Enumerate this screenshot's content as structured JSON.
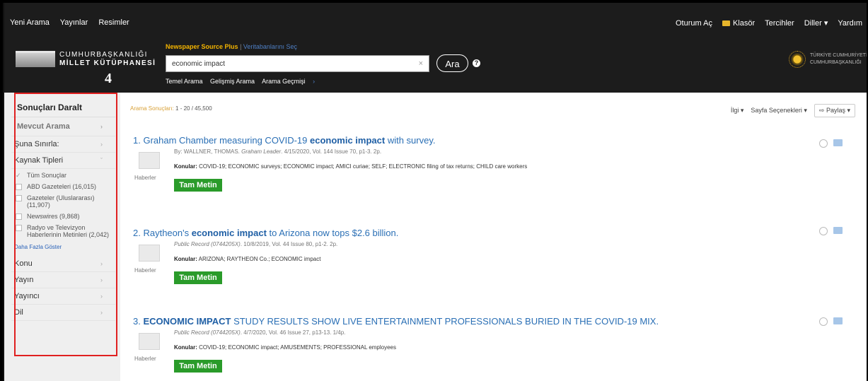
{
  "topnav": {
    "links": [
      "Yeni Arama",
      "Yayınlar",
      "Resimler"
    ]
  },
  "topnav_right": {
    "oturum": "Oturum Aç",
    "klasor": "Klasör",
    "tercihler": "Tercihler",
    "diller": "Diller ▾",
    "yardim": "Yardım"
  },
  "logo": {
    "line1": "CUMHURBAŞKANLIĞI",
    "line2": "MİLLET KÜTÜPHANESİ"
  },
  "annotation_number": "4",
  "search": {
    "database": "Newspaper Source Plus",
    "select_db": "Veritabanlarını Seç",
    "query": "economic impact",
    "button": "Ara",
    "help": "?"
  },
  "search_links": [
    "Temel Arama",
    "Gelişmiş Arama",
    "Arama Geçmişi"
  ],
  "gov_logo": {
    "line1": "TÜRKİYE CUMHURİYETİ",
    "line2": "CUMHURBAŞKANLIĞI"
  },
  "sidebar": {
    "title": "Sonuçları Daralt",
    "current": "Mevcut Arama",
    "limit": "Şuna Sınırla:",
    "source_types": "Kaynak Tipleri",
    "options": [
      {
        "label": "Tüm Sonuçlar",
        "checked": true
      },
      {
        "label": "ABD Gazeteleri (16,015)",
        "checked": false
      },
      {
        "label": "Gazeteler (Uluslararası) (11,907)",
        "checked": false
      },
      {
        "label": "Newswires (9,868)",
        "checked": false
      },
      {
        "label": "Radyo ve Televizyon Haberlerinin Metinleri (2,042)",
        "checked": false
      }
    ],
    "more": "Daha Fazla Göster",
    "facets": [
      "Konu",
      "Yayın",
      "Yayıncı",
      "Dil"
    ]
  },
  "results_header": {
    "label": "Arama Sonuçları:",
    "range": "1 - 20 / 45,500"
  },
  "tools": {
    "relevance": "İlgi ▾",
    "page_options": "Sayfa Seçenekleri ▾",
    "share": "Paylaş ▾"
  },
  "results": [
    {
      "num": "1.",
      "title_a": "Graham Chamber measuring COVID-19 ",
      "title_b": "economic impact",
      "title_c": " with survey.",
      "by": "By: WALLNER, THOMAS. ",
      "source": "Graham Leader",
      "details": ". 4/15/2020, Vol. 144 Issue 70, p1-3. 2p.",
      "kon_label": "Konular:",
      "kon_text": "COVID-19; ECONOMIC surveys; ECONOMIC impact; AMICI curiae; SELF; ELECTRONIC filing of tax returns; CHILD care workers",
      "category": "Haberler",
      "button": "Tam Metin"
    },
    {
      "num": "2.",
      "title_a": "Raytheon's ",
      "title_b": "economic impact",
      "title_c": " to Arizona now tops $2.6 billion.",
      "by": "",
      "source": "Public Record (0744205X)",
      "details": ". 10/8/2019, Vol. 44 Issue 80, p1-2. 2p.",
      "kon_label": "Konular:",
      "kon_text": "ARIZONA; RAYTHEON Co.; ECONOMIC impact",
      "category": "Haberler",
      "button": "Tam Metin"
    },
    {
      "num": "3.",
      "title_a": "",
      "title_b": "ECONOMIC IMPACT",
      "title_c": " STUDY RESULTS SHOW LIVE ENTERTAINMENT PROFESSIONALS BURIED IN THE COVID-19 MIX.",
      "by": "",
      "source": "Public Record (0744205X)",
      "details": ". 4/7/2020, Vol. 46 Issue 27, p13-13. 1/4p.",
      "kon_label": "Konular:",
      "kon_text": "COVID-19; ECONOMIC impact; AMUSEMENTS; PROFESSIONAL employees",
      "category": "Haberler",
      "button": "Tam Metin"
    }
  ]
}
